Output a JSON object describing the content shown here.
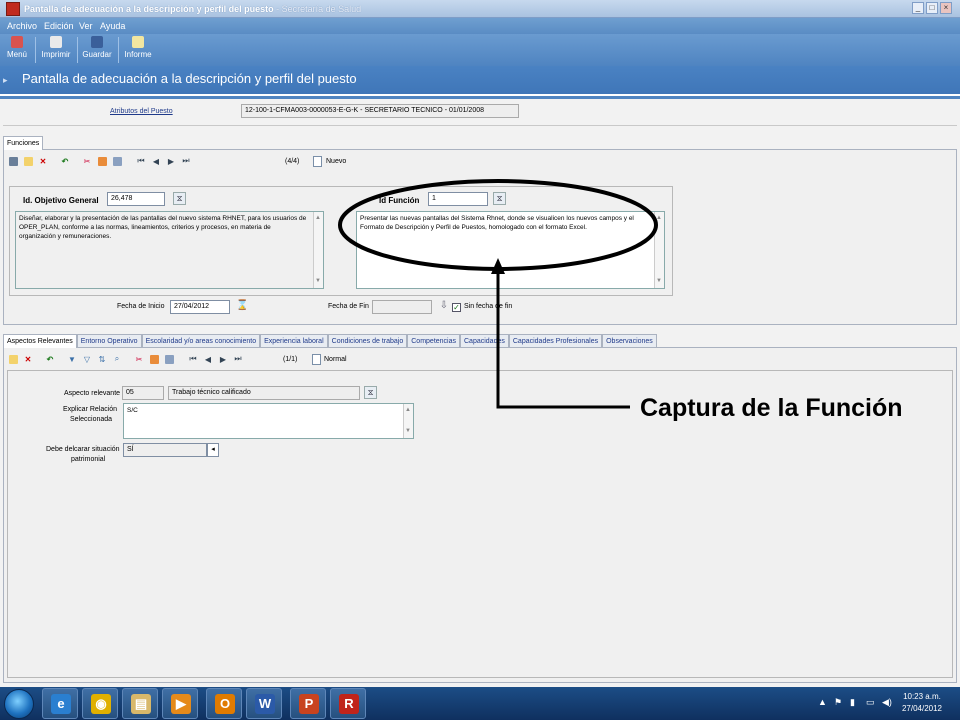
{
  "window": {
    "title": "Pantalla de adecuación a la descripción y perfil del puesto",
    "title_suffix": " - Secretaría de Salud",
    "minimize": "_",
    "restore": "□",
    "close": "×"
  },
  "menu": {
    "items": [
      "Archivo",
      "Edición",
      "Ver",
      "Ayuda"
    ]
  },
  "toolbar": {
    "buttons": [
      {
        "label": "Menú",
        "icon": "menu-icon",
        "color": "#d9534f"
      },
      {
        "label": "Imprimir",
        "icon": "printer-icon",
        "color": "#eaeaea"
      },
      {
        "label": "Guardar",
        "icon": "floppy-icon",
        "color": "#3a5f9a"
      },
      {
        "label": "Informe",
        "icon": "report-icon",
        "color": "#f2e6a0"
      }
    ]
  },
  "header": {
    "title": "Pantalla de adecuación a la descripción y perfil del puesto",
    "icon": "▸"
  },
  "atributos": {
    "link": "Atributos del Puesto",
    "value": "12-100-1-CFMA003-0000053-E-G-K - SECRETARIO TECNICO - 01/01/2008"
  },
  "funciones": {
    "tab": "Funciones",
    "record_counter": "(4/4)",
    "status": "Nuevo",
    "id_objetivo_label": "Id. Objetivo General",
    "id_objetivo_value": "26,478",
    "objetivo_text": "Diseñar, elaborar y la presentación de las pantallas del nuevo sistema RHNET, para los usuarios de OPER_PLAN, conforme a las normas, lineamientos, criterios y procesos, en materia de organización y remuneraciones.",
    "id_funcion_label": "Id Función",
    "id_funcion_value": "1",
    "funcion_text": "Presentar las nuevas pantallas del Sistema Rhnet, donde se visualicen los nuevos campos y el Formato de Descripción y Perfil de Puestos, homologado con el formato Excel.",
    "fecha_inicio_label": "Fecha de Inicio",
    "fecha_inicio_value": "27/04/2012",
    "fecha_fin_label": "Fecha de Fin",
    "fecha_fin_value": "",
    "sin_fecha_label": "Sin fecha de fin",
    "sin_fecha_checked": true
  },
  "lower_tabs": [
    "Aspectos Relevantes",
    "Entorno Operativo",
    "Escolaridad y/o areas conocimiento",
    "Experiencia laboral",
    "Condiciones de trabajo",
    "Competencias",
    "Capacidades",
    "Capacidades Profesionales",
    "Observaciones"
  ],
  "aspectos": {
    "record_counter": "(1/1)",
    "status": "Normal",
    "aspecto_label": "Aspecto relevante",
    "aspecto_code": "05",
    "aspecto_desc": "Trabajo técnico calificado",
    "explicar_label_1": "Explicar Relación",
    "explicar_label_2": "Seleccionada",
    "explicar_value": "S/C",
    "debe_label_1": "Debe delcarar situación",
    "debe_label_2": "patrimonial",
    "debe_value": "SÍ"
  },
  "annotation": {
    "callout": "Captura de la Función",
    "color": "#000000"
  },
  "taskbar": {
    "apps": [
      {
        "icon": "internet-explorer-icon",
        "glyph": "e",
        "color": "#2a7fd0"
      },
      {
        "icon": "chrome-icon",
        "glyph": "◉",
        "color": "#e0b000"
      },
      {
        "icon": "file-explorer-icon",
        "glyph": "▤",
        "color": "#d8b86a"
      },
      {
        "icon": "media-player-icon",
        "glyph": "▶",
        "color": "#e58a1a"
      },
      {
        "icon": "outlook-icon",
        "glyph": "O",
        "color": "#e07b00"
      },
      {
        "icon": "word-icon",
        "glyph": "W",
        "color": "#2b5aa8"
      },
      {
        "icon": "powerpoint-icon",
        "glyph": "P",
        "color": "#c8431f"
      },
      {
        "icon": "rhnet-app-icon",
        "glyph": "R",
        "color": "#c0241b"
      }
    ],
    "time": "10:23 a.m.",
    "date": "27/04/2012"
  }
}
